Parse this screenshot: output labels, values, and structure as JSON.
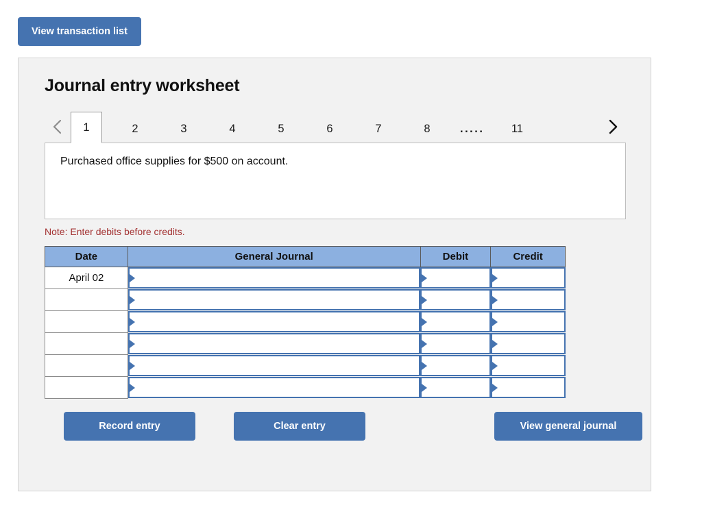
{
  "toolbar": {
    "view_transaction_list_label": "View transaction list"
  },
  "worksheet": {
    "title": "Journal entry worksheet",
    "prev_icon": "chevron-left-icon",
    "next_icon": "chevron-right-icon",
    "tabs": [
      {
        "label": "1",
        "active": true
      },
      {
        "label": "2",
        "active": false
      },
      {
        "label": "3",
        "active": false
      },
      {
        "label": "4",
        "active": false
      },
      {
        "label": "5",
        "active": false
      },
      {
        "label": "6",
        "active": false
      },
      {
        "label": "7",
        "active": false
      },
      {
        "label": "8",
        "active": false
      },
      {
        "label": "11",
        "active": false
      }
    ],
    "tab_ellipsis": ".....",
    "description": "Purchased office supplies for $500 on account.",
    "note": "Note: Enter debits before credits."
  },
  "journal_table": {
    "headers": [
      "Date",
      "General Journal",
      "Debit",
      "Credit"
    ],
    "rows": [
      {
        "date": "April 02",
        "general_journal": "",
        "debit": "",
        "credit": ""
      },
      {
        "date": "",
        "general_journal": "",
        "debit": "",
        "credit": ""
      },
      {
        "date": "",
        "general_journal": "",
        "debit": "",
        "credit": ""
      },
      {
        "date": "",
        "general_journal": "",
        "debit": "",
        "credit": ""
      },
      {
        "date": "",
        "general_journal": "",
        "debit": "",
        "credit": ""
      },
      {
        "date": "",
        "general_journal": "",
        "debit": "",
        "credit": ""
      }
    ]
  },
  "actions": {
    "record_entry_label": "Record entry",
    "clear_entry_label": "Clear entry",
    "view_general_journal_label": "View general journal"
  },
  "colors": {
    "accent_blue": "#4573b0",
    "header_blue": "#8cb0e0",
    "note_red": "#a33232",
    "card_bg": "#f2f2f2"
  }
}
